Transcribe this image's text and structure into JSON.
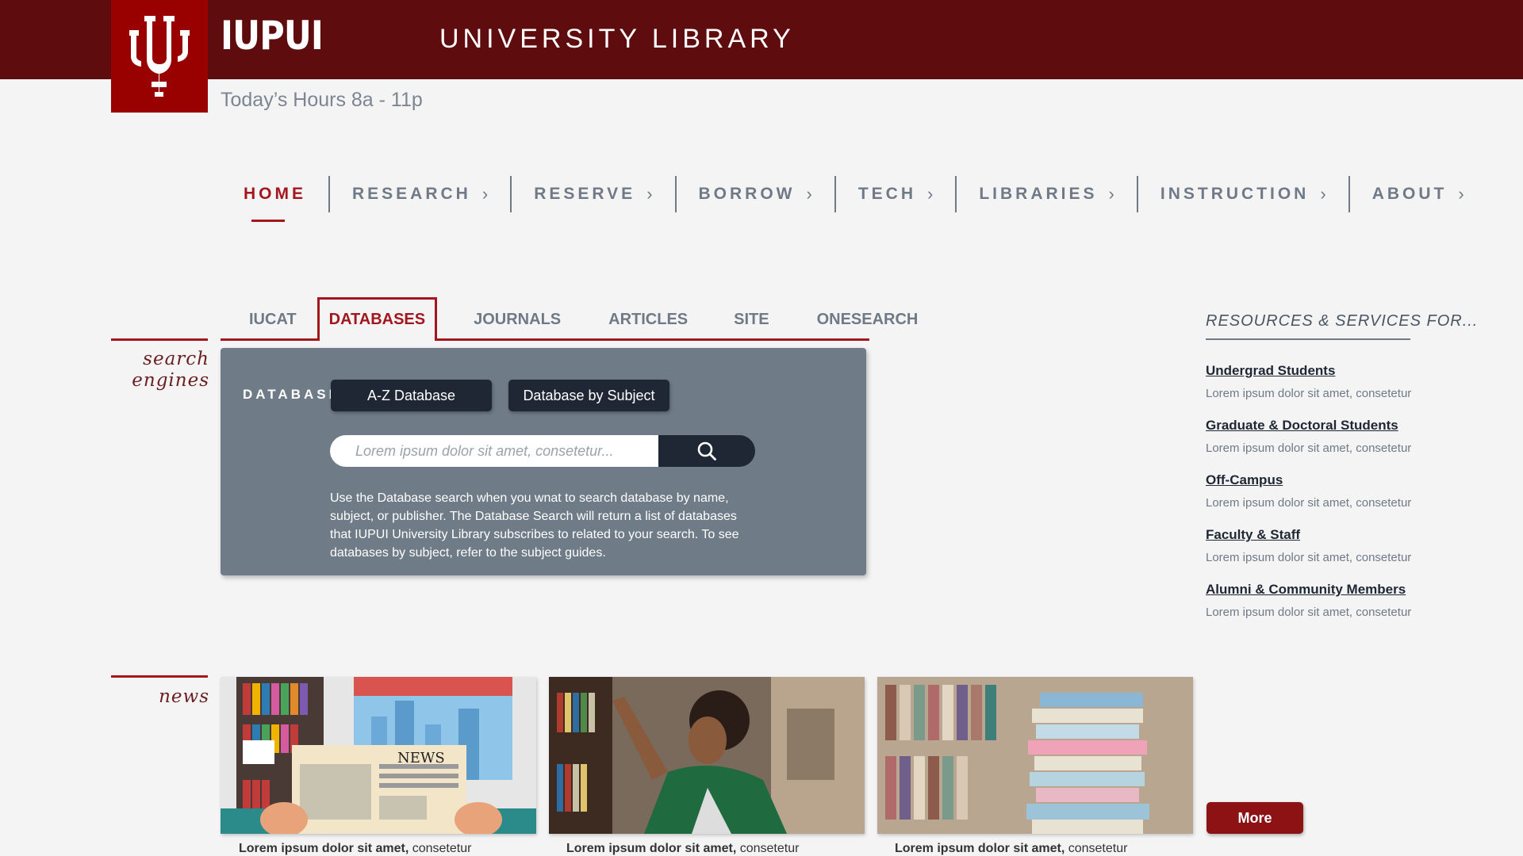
{
  "header": {
    "brand": "IUPUI",
    "title": "UNIVERSITY LIBRARY",
    "hours": "Today’s Hours 8a - 11p"
  },
  "nav": {
    "items": [
      {
        "label": "HOME"
      },
      {
        "label": "RESEARCH"
      },
      {
        "label": "RESERVE"
      },
      {
        "label": "BORROW"
      },
      {
        "label": "TECH"
      },
      {
        "label": "LIBRARIES"
      },
      {
        "label": "INSTRUCTION"
      },
      {
        "label": "ABOUT"
      }
    ]
  },
  "sections": {
    "search_label_1": "search",
    "search_label_2": "engines",
    "news_label": "news"
  },
  "search": {
    "tabs": [
      "IUCAT",
      "DATABASES",
      "JOURNALS",
      "ARTICLES",
      "SITE",
      "ONESEARCH"
    ],
    "panel_label": "DATABASES",
    "az_button": "A-Z Database",
    "subject_button": "Database by Subject",
    "placeholder": "Lorem ipsum dolor sit amet, consetetur...",
    "description": "Use the Database search when you wnat to search database by name, subject, or publisher. The Database Search will return a list of databases that IUPUI University Library subscribes to related to your search. To see databases by subject, refer to the subject guides."
  },
  "resources": {
    "heading": "RESOURCES & SERVICES FOR...",
    "items": [
      {
        "label": "Undergrad Students",
        "desc": "Lorem ipsum dolor sit amet, consetetur"
      },
      {
        "label": "Graduate & Doctoral Students",
        "desc": "Lorem ipsum dolor sit amet, consetetur"
      },
      {
        "label": "Off-Campus",
        "desc": "Lorem ipsum dolor sit amet, consetetur"
      },
      {
        "label": "Faculty & Staff",
        "desc": "Lorem ipsum dolor sit amet, consetetur"
      },
      {
        "label": "Alumni & Community Members",
        "desc": "Lorem ipsum dolor sit amet, consetetur"
      }
    ]
  },
  "news": {
    "newspaper_text": "NEWS",
    "cards": [
      {
        "bold": "Lorem ipsum dolor sit amet,",
        "rest": " consetetur"
      },
      {
        "bold": "Lorem ipsum dolor sit amet,",
        "rest": " consetetur"
      },
      {
        "bold": "Lorem ipsum dolor sit amet,",
        "rest": " consetetur"
      }
    ],
    "more_label": "More"
  },
  "colors": {
    "header_bg": "#5e0c0d",
    "logo_bg": "#990000",
    "accent": "#a3161e",
    "panel_bg": "#6f7b86",
    "dark_button": "#1e2733",
    "more_button": "#8c1214"
  }
}
